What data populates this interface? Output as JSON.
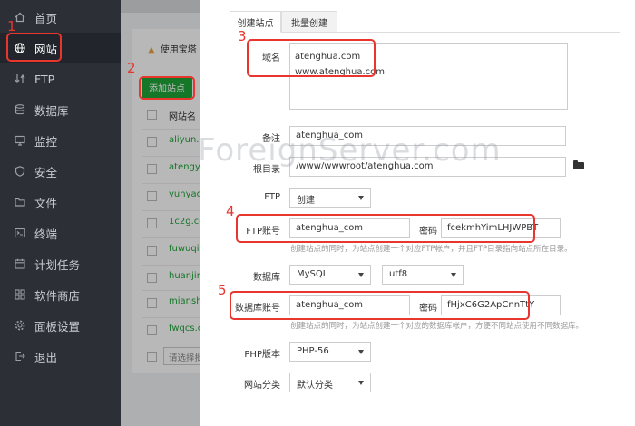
{
  "sidebar": {
    "items": [
      {
        "label": "首页",
        "icon": "home-icon"
      },
      {
        "label": "网站",
        "icon": "globe-icon"
      },
      {
        "label": "FTP",
        "icon": "ftp-icon"
      },
      {
        "label": "数据库",
        "icon": "database-icon"
      },
      {
        "label": "监控",
        "icon": "monitor-icon"
      },
      {
        "label": "安全",
        "icon": "shield-icon"
      },
      {
        "label": "文件",
        "icon": "folder-icon"
      },
      {
        "label": "终端",
        "icon": "terminal-icon"
      },
      {
        "label": "计划任务",
        "icon": "calendar-icon"
      },
      {
        "label": "软件商店",
        "icon": "app-store-icon"
      },
      {
        "label": "面板设置",
        "icon": "gear-icon"
      },
      {
        "label": "退出",
        "icon": "logout-icon"
      }
    ]
  },
  "background": {
    "warning": "使用宝塔",
    "add_site_button": "添加站点",
    "column_site_name": "网站名",
    "sites": [
      "aliyun.h",
      "atengyu",
      "yunyaoy",
      "1c2g.co",
      "fuwuqib",
      "huanjing",
      "mianshi",
      "fwqcs.c"
    ],
    "batch_placeholder": "请选择批"
  },
  "modal": {
    "tabs": [
      "创建站点",
      "批量创建"
    ],
    "domain": {
      "label": "域名",
      "lines": [
        "atenghua.com",
        "www.atenghua.com"
      ]
    },
    "remark": {
      "label": "备注",
      "value": "atenghua_com"
    },
    "root": {
      "label": "根目录",
      "value": "/www/wwwroot/atenghua.com"
    },
    "ftp": {
      "label": "FTP",
      "value": "创建"
    },
    "ftp_account": {
      "label": "FTP账号",
      "value": "atenghua_com",
      "password_label": "密码",
      "password": "fcekmhYimLHJWPBT",
      "help": "创建站点的同时，为站点创建一个对应FTP帐户，并且FTP目录指向站点所在目录。"
    },
    "database": {
      "label": "数据库",
      "type": "MySQL",
      "charset": "utf8"
    },
    "db_account": {
      "label": "数据库账号",
      "value": "atenghua_com",
      "password_label": "密码",
      "password": "fHjxC6G2ApCnnTtY",
      "help": "创建站点的同时，为站点创建一个对应的数据库帐户，方便不同站点使用不同数据库。"
    },
    "php": {
      "label": "PHP版本",
      "value": "PHP-56"
    },
    "category": {
      "label": "网站分类",
      "value": "默认分类"
    }
  },
  "annotations": [
    "1",
    "2",
    "3",
    "4",
    "5"
  ],
  "watermark": "ForeignServer.com",
  "colors": {
    "accent_green": "#20a53a",
    "annotation_red": "#e8352e",
    "sidebar_bg": "#2c2f36"
  }
}
